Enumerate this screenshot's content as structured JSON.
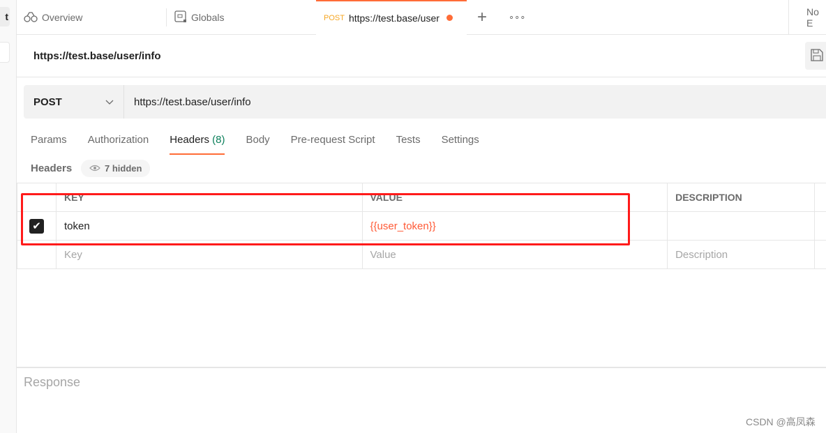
{
  "sidebar": {
    "button_fragment": "t"
  },
  "tabs": [
    {
      "label": "Overview",
      "icon": "binoculars-icon"
    },
    {
      "label": "Globals",
      "icon": "globals-icon"
    },
    {
      "method": "POST",
      "label": "https://test.base/user",
      "unsaved": true
    }
  ],
  "tabbar": {
    "new_tab": "+",
    "more": "∘∘∘",
    "environment": "No E"
  },
  "request": {
    "title": "https://test.base/user/info",
    "method": "POST",
    "url": "https://test.base/user/info"
  },
  "request_tabs": [
    {
      "label": "Params"
    },
    {
      "label": "Authorization"
    },
    {
      "label": "Headers",
      "count": "(8)",
      "active": true
    },
    {
      "label": "Body"
    },
    {
      "label": "Pre-request Script"
    },
    {
      "label": "Tests"
    },
    {
      "label": "Settings"
    }
  ],
  "headers": {
    "label": "Headers",
    "hidden": "7 hidden",
    "columns": [
      "KEY",
      "VALUE",
      "DESCRIPTION"
    ],
    "rows": [
      {
        "checked": true,
        "key": "token",
        "value": "{{user_token}}",
        "description": ""
      }
    ],
    "placeholders": {
      "key": "Key",
      "value": "Value",
      "description": "Description"
    }
  },
  "response": {
    "label": "Response"
  },
  "watermark": "CSDN @高凤森",
  "colors": {
    "accent": "#ff6c37",
    "variable": "#ff5a36",
    "highlight": "#ff1a1a"
  }
}
